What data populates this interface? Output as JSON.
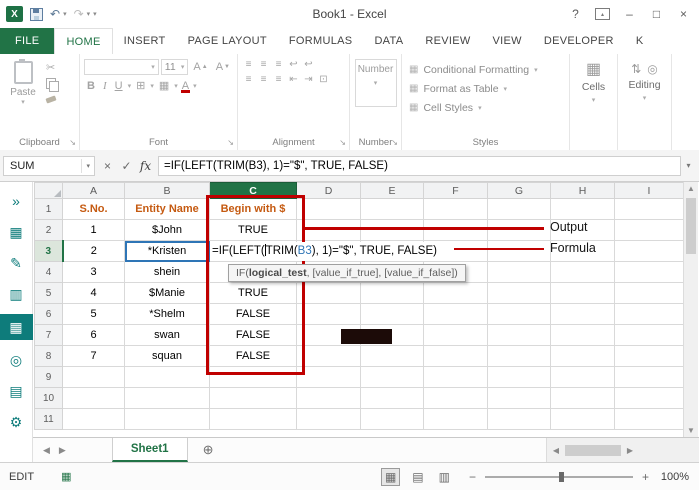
{
  "window": {
    "title": "Book1 - Excel"
  },
  "icons": {
    "logo": "X",
    "undo": "↶",
    "redo": "↷",
    "dropdown": "▾",
    "help": "?",
    "ribbon_display": "▴",
    "minimize": "–",
    "maximize": "□",
    "close": "×",
    "cut": "✂",
    "dialog_launcher": "↘",
    "grow_font": "A",
    "shrink_font": "A",
    "bold": "B",
    "italic": "I",
    "underline": "U",
    "borders": "⊞",
    "fill_color": "▦",
    "font_color": "A",
    "align": "≡",
    "wrap": "↩",
    "indent_left": "⇤",
    "indent_right": "⇥",
    "merge": "⊡",
    "styles_item": "▦",
    "cells_icon": "▦",
    "sort_icon": "⇅",
    "find_icon": "◎",
    "cancel": "×",
    "enter": "✓",
    "fx": "fx",
    "up_arrow": "▲",
    "down_arrow": "▼",
    "left_arrow": "◀",
    "right_arrow": "▶",
    "new_sheet": "⊕",
    "view_normal": "▦",
    "view_layout": "▤",
    "view_break": "▥",
    "zoom_out": "−",
    "zoom_in": "+",
    "macro": "▦",
    "sidebar": [
      "»",
      "▦",
      "✎",
      "▥",
      "▦",
      "◎",
      "▤",
      "⚙"
    ]
  },
  "tabs": [
    "FILE",
    "HOME",
    "INSERT",
    "PAGE LAYOUT",
    "FORMULAS",
    "DATA",
    "REVIEW",
    "VIEW",
    "DEVELOPER",
    "K"
  ],
  "ribbon": {
    "paste": "Paste",
    "font_size": "11",
    "number_label": "Number",
    "styles": [
      "Conditional Formatting",
      "Format as Table",
      "Cell Styles"
    ],
    "cells": "Cells",
    "editing": "Editing",
    "captions": {
      "clipboard": "Clipboard",
      "font": "Font",
      "alignment": "Alignment",
      "number": "Number",
      "styles": "Styles"
    }
  },
  "formula_bar": {
    "name_box": "SUM",
    "formula": "=IF(LEFT(TRIM(B3), 1)=\"$\", TRUE, FALSE)"
  },
  "grid": {
    "col_headers": [
      "A",
      "B",
      "C",
      "D",
      "E",
      "F",
      "G",
      "H",
      "I"
    ],
    "row_headers": [
      "1",
      "2",
      "3",
      "4",
      "5",
      "6",
      "7",
      "8",
      "9",
      "10",
      "11"
    ],
    "headers": {
      "sno": "S.No.",
      "name": "Entity Name",
      "result": "Begin with $"
    },
    "rows": [
      {
        "sno": "1",
        "name": "$John",
        "result": "TRUE"
      },
      {
        "sno": "2",
        "name": "*Kristen",
        "result": ""
      },
      {
        "sno": "3",
        "name": "shein",
        "result": ""
      },
      {
        "sno": "4",
        "name": "$Manie",
        "result": "TRUE"
      },
      {
        "sno": "5",
        "name": "*Shelm",
        "result": "FALSE"
      },
      {
        "sno": "6",
        "name": "swan",
        "result": "FALSE"
      },
      {
        "sno": "7",
        "name": "squan",
        "result": "FALSE"
      }
    ],
    "edit_formula": {
      "pre1": "=IF(LEFT(",
      "pre2": "TRIM(",
      "ref": "B3",
      "post": "), 1)=\"$\", TRUE, FALSE)"
    },
    "tooltip": {
      "fn": "IF(",
      "arg": "logical_test",
      "rest": ", [value_if_true], [value_if_false])"
    }
  },
  "annotations": {
    "output": "Output",
    "formula": "Formula"
  },
  "sheet_bar": {
    "active_tab": "Sheet1"
  },
  "status_bar": {
    "mode": "EDIT",
    "zoom": "100%"
  }
}
